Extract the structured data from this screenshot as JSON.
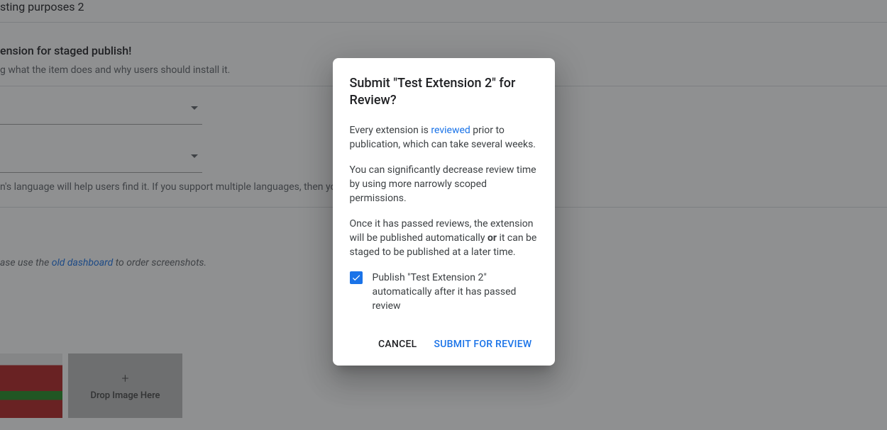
{
  "background": {
    "description_value": "sting purposes 2",
    "headline": "ension for staged publish!",
    "summary_helper": "g what the item does and why users should install it.",
    "language_helper": "n's language will help users find it. If you support multiple languages, then you sh",
    "screenshots_note_prefix": "ase use the ",
    "screenshots_note_link": "old dashboard",
    "screenshots_note_suffix": " to order screenshots.",
    "dropzone_label": "Drop Image Here"
  },
  "dialog": {
    "title": "Submit \"Test Extension 2\" for Review?",
    "para1_prefix": "Every extension is ",
    "para1_link": "reviewed",
    "para1_suffix": " prior to publication, which can take several weeks.",
    "para2": "You can significantly decrease review time by using more narrowly scoped permissions.",
    "para3_prefix": "Once it has passed reviews, the extension will be published automatically ",
    "para3_bold": "or",
    "para3_suffix": " it can be staged to be published at a later time.",
    "checkbox_label": "Publish \"Test Extension 2\" automatically after it has passed review",
    "checkbox_checked": true,
    "actions": {
      "cancel": "Cancel",
      "submit": "Submit for Review"
    }
  }
}
